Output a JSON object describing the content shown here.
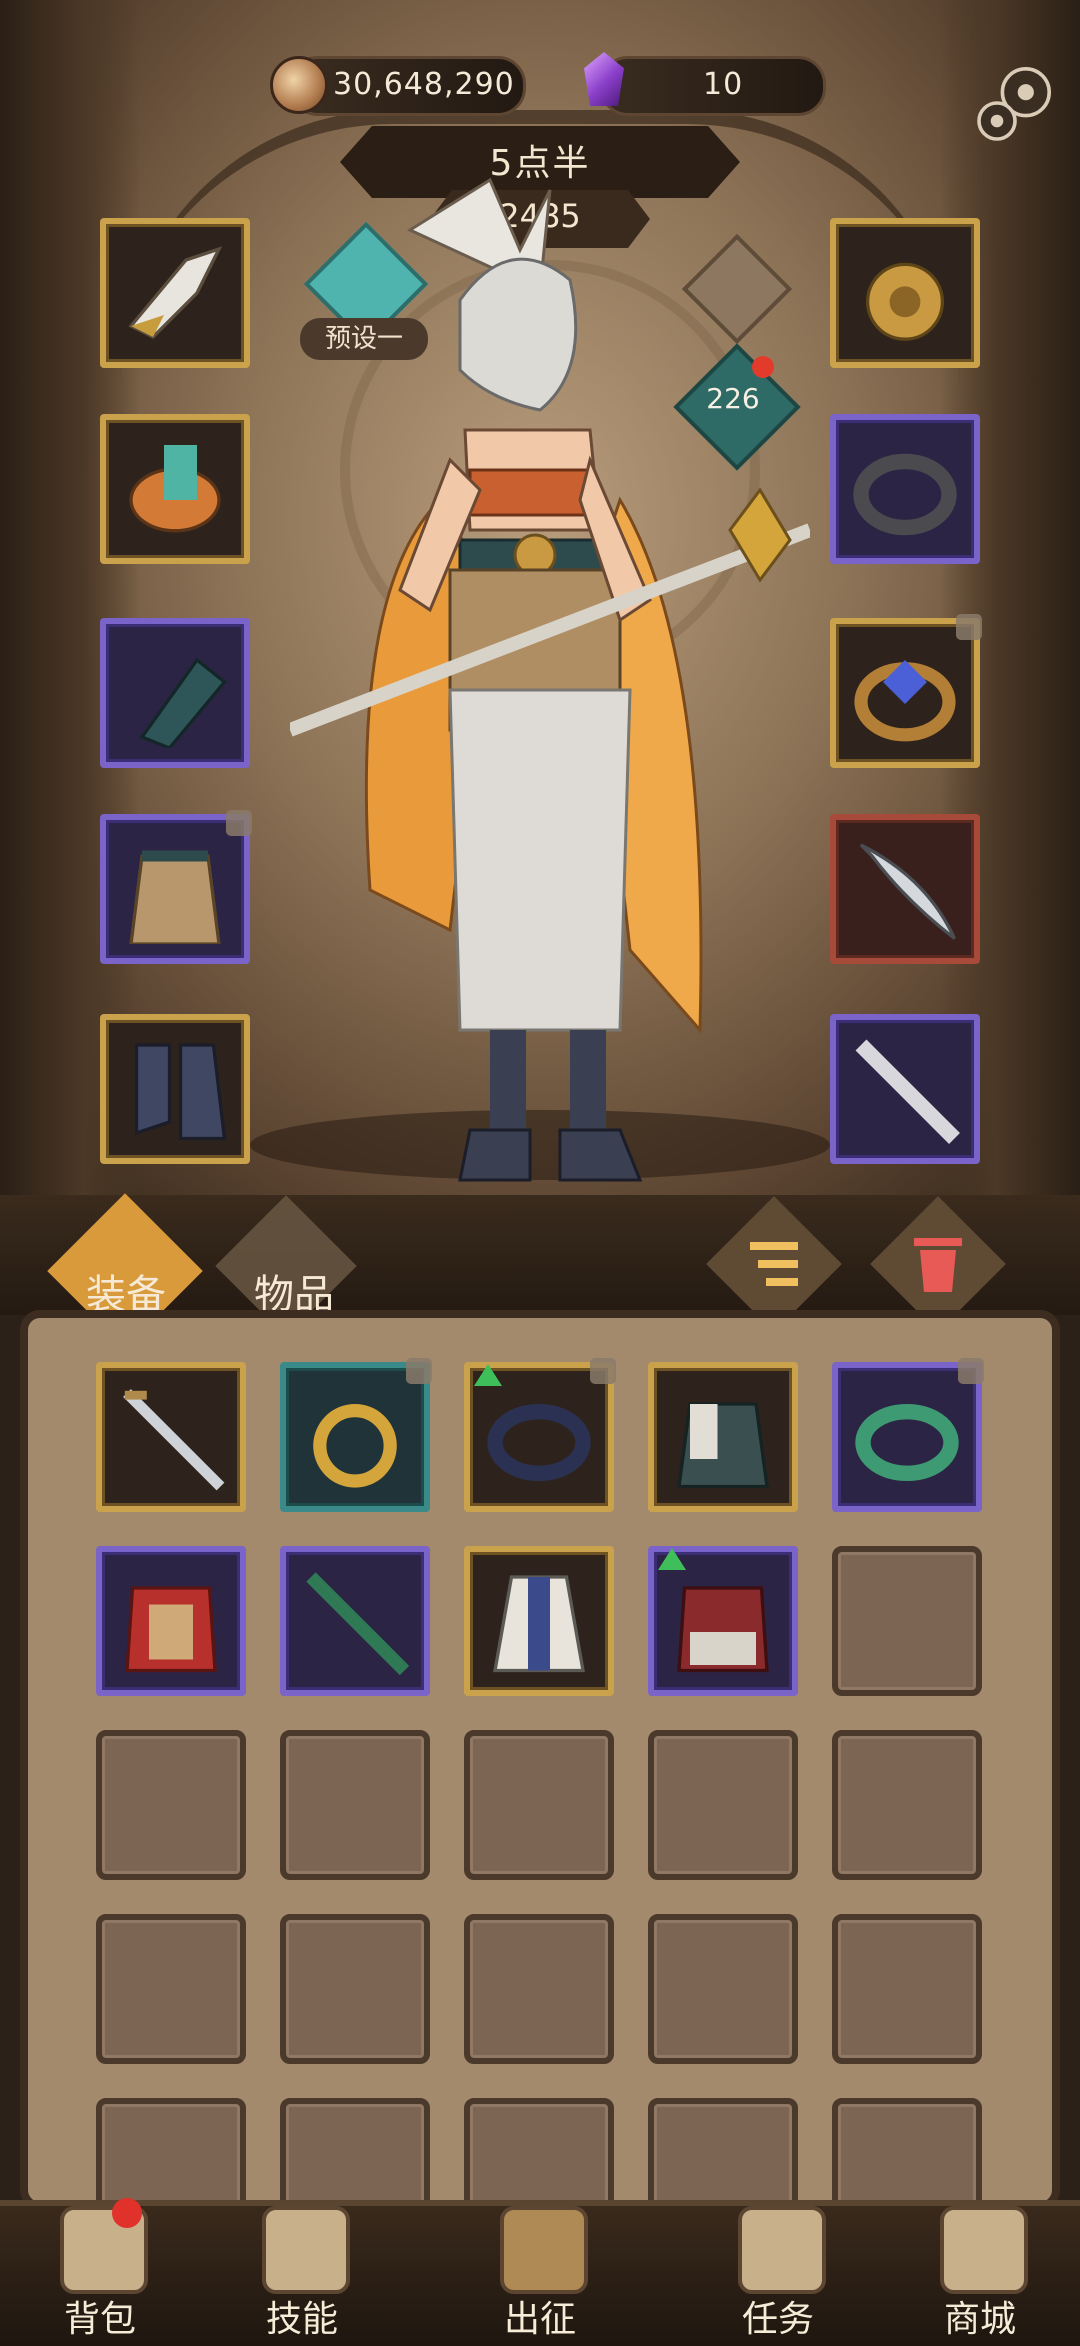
{
  "currency": {
    "gold": "30,648,290",
    "gems": "10"
  },
  "hero": {
    "name": "5点半",
    "power": "2485",
    "preset_label": "预设一",
    "level": "226"
  },
  "equipped_left": [
    {
      "name": "winged-helmet",
      "rarity": "gold"
    },
    {
      "name": "shoulder-armor",
      "rarity": "gold"
    },
    {
      "name": "bracer",
      "rarity": "purple"
    },
    {
      "name": "waist-skirt",
      "rarity": "purple",
      "locked": true
    },
    {
      "name": "boots",
      "rarity": "gold"
    }
  ],
  "equipped_right": [
    {
      "name": "lion-amulet",
      "rarity": "gold"
    },
    {
      "name": "iron-ring",
      "rarity": "purple"
    },
    {
      "name": "gem-bracelet",
      "rarity": "gold",
      "locked": true
    },
    {
      "name": "curved-sword",
      "rarity": "red"
    },
    {
      "name": "silver-staff",
      "rarity": "purple"
    }
  ],
  "tabs": {
    "equipment": "装备",
    "items": "物品"
  },
  "inventory": [
    {
      "name": "steel-sword",
      "rarity": "gold"
    },
    {
      "name": "crescent-necklace",
      "rarity": "teal",
      "locked": true
    },
    {
      "name": "dark-ring",
      "rarity": "gold",
      "locked": true,
      "upgrade": true
    },
    {
      "name": "layered-robe",
      "rarity": "gold"
    },
    {
      "name": "jade-ring",
      "rarity": "purple",
      "locked": true
    },
    {
      "name": "red-armor",
      "rarity": "purple"
    },
    {
      "name": "jade-staff",
      "rarity": "purple"
    },
    {
      "name": "blue-skirt",
      "rarity": "gold"
    },
    {
      "name": "crimson-coat",
      "rarity": "purple",
      "upgrade": true
    },
    {
      "name": "empty",
      "rarity": "empty"
    },
    {
      "name": "empty",
      "rarity": "empty"
    },
    {
      "name": "empty",
      "rarity": "empty"
    },
    {
      "name": "empty",
      "rarity": "empty"
    },
    {
      "name": "empty",
      "rarity": "empty"
    },
    {
      "name": "empty",
      "rarity": "empty"
    },
    {
      "name": "empty",
      "rarity": "empty"
    },
    {
      "name": "empty",
      "rarity": "empty"
    },
    {
      "name": "empty",
      "rarity": "empty"
    },
    {
      "name": "empty",
      "rarity": "empty"
    },
    {
      "name": "empty",
      "rarity": "empty"
    },
    {
      "name": "empty",
      "rarity": "empty"
    },
    {
      "name": "empty",
      "rarity": "empty"
    },
    {
      "name": "empty",
      "rarity": "empty"
    },
    {
      "name": "empty",
      "rarity": "empty"
    },
    {
      "name": "empty",
      "rarity": "empty"
    }
  ],
  "nav": {
    "bag": "背包",
    "skills": "技能",
    "expedition": "出征",
    "tasks": "任务",
    "shop": "商城"
  },
  "colors": {
    "rarity_gold": "#c9a24b",
    "rarity_purple": "#7a63c9",
    "rarity_red": "#a84a3a",
    "rarity_teal": "#3a8a8a",
    "notification_red": "#e33b2b",
    "upgrade_green": "#3fbf5a"
  }
}
